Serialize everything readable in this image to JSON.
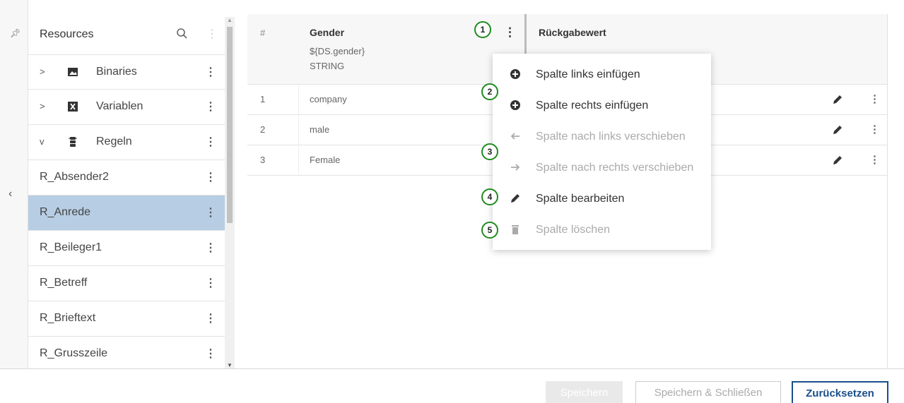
{
  "sidebar": {
    "title": "Resources",
    "groups": [
      {
        "label": "Binaries",
        "chevron": ">"
      },
      {
        "label": "Variablen",
        "chevron": ">"
      },
      {
        "label": "Regeln",
        "chevron": "v"
      }
    ],
    "items": [
      {
        "label": "R_Absender2"
      },
      {
        "label": "R_Anrede"
      },
      {
        "label": "R_Beileger1"
      },
      {
        "label": "R_Betreff"
      },
      {
        "label": "R_Brieftext"
      },
      {
        "label": "R_Grusszeile"
      }
    ],
    "selected": "R_Anrede"
  },
  "table": {
    "hash_header": "#",
    "column1": {
      "title": "Gender",
      "expression": "${DS.gender}",
      "type": "STRING"
    },
    "column2": {
      "title": "Rückgabewert"
    },
    "rows": [
      {
        "num": "1",
        "value": "company"
      },
      {
        "num": "2",
        "value": "male"
      },
      {
        "num": "3",
        "value": "Female"
      }
    ]
  },
  "context_menu": {
    "items": [
      {
        "label": "Spalte links einfügen",
        "icon": "plus-circle-icon",
        "enabled": true
      },
      {
        "label": "Spalte rechts einfügen",
        "icon": "plus-circle-icon",
        "enabled": true
      },
      {
        "label": "Spalte nach links verschieben",
        "icon": "arrow-left-icon",
        "enabled": false
      },
      {
        "label": "Spalte nach rechts verschieben",
        "icon": "arrow-right-icon",
        "enabled": false
      },
      {
        "label": "Spalte bearbeiten",
        "icon": "pencil-icon",
        "enabled": true
      },
      {
        "label": "Spalte löschen",
        "icon": "trash-icon",
        "enabled": false
      }
    ]
  },
  "badges": [
    "1",
    "2",
    "3",
    "4",
    "5"
  ],
  "footer": {
    "save": "Speichern",
    "save_close": "Speichern & Schließen",
    "reset": "Zurücksetzen"
  },
  "colors": {
    "selected_row": "#b7cde3",
    "primary": "#1a4f8b",
    "badge_ring": "#1f8a1f"
  }
}
